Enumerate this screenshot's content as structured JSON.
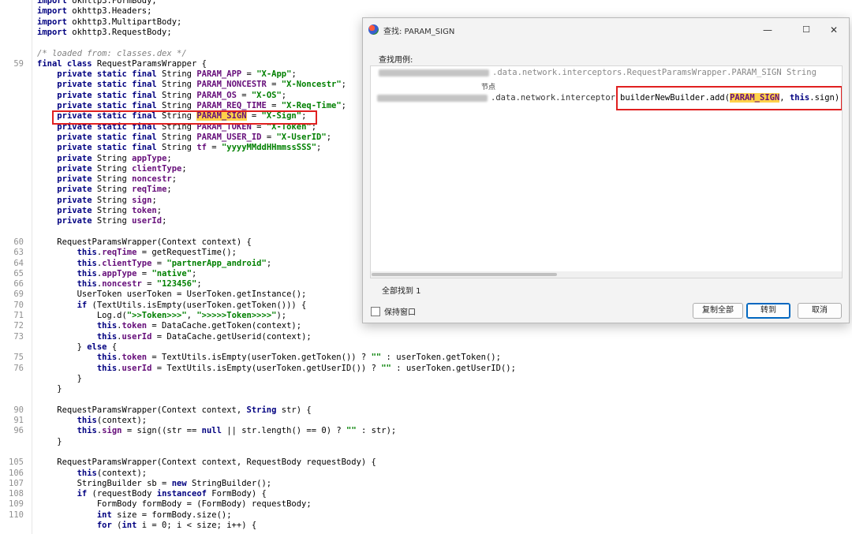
{
  "code_lines": [
    {
      "n": "",
      "html": "<span class=\"kw\">import</span> okhttp3.FormBody;"
    },
    {
      "n": "",
      "html": "<span class=\"kw\">import</span> okhttp3.Headers;"
    },
    {
      "n": "",
      "html": "<span class=\"kw\">import</span> okhttp3.MultipartBody;"
    },
    {
      "n": "",
      "html": "<span class=\"kw\">import</span> okhttp3.RequestBody;"
    },
    {
      "n": "",
      "html": ""
    },
    {
      "n": "",
      "html": "<span class=\"cm\">/* loaded from: classes.dex */</span>"
    },
    {
      "n": "59",
      "html": "<span class=\"kw\">final class</span> RequestParamsWrapper {"
    },
    {
      "n": "",
      "html": "    <span class=\"kw\">private static final</span> String <span class=\"fld\">PARAM_APP</span> = <span class=\"str\">\"X-App\"</span>;"
    },
    {
      "n": "",
      "html": "    <span class=\"kw\">private static final</span> String <span class=\"fld\">PARAM_NONCESTR</span> = <span class=\"str\">\"X-Noncestr\"</span>;"
    },
    {
      "n": "",
      "html": "    <span class=\"kw\">private static final</span> String <span class=\"fld\">PARAM_OS</span> = <span class=\"str\">\"X-OS\"</span>;"
    },
    {
      "n": "",
      "html": "    <span class=\"kw\">private static final</span> String <span class=\"fld\">PARAM_REQ_TIME</span> = <span class=\"str\">\"X-Req-Time\"</span>;"
    },
    {
      "n": "",
      "html": "    <span class=\"kw\">private static final</span> String <span class=\"fld hl\">PARAM_SIGN</span> = <span class=\"str\">\"X-Sign\"</span>;"
    },
    {
      "n": "",
      "html": "    <span class=\"kw\">private static final</span> String <span class=\"fld\">PARAM_TOKEN</span> = <span class=\"str\">\"X-Token\"</span>;"
    },
    {
      "n": "",
      "html": "    <span class=\"kw\">private static final</span> String <span class=\"fld\">PARAM_USER_ID</span> = <span class=\"str\">\"X-UserID\"</span>;"
    },
    {
      "n": "",
      "html": "    <span class=\"kw\">private static final</span> String <span class=\"fld\">tf</span> = <span class=\"str\">\"yyyyMMddHHmmssSSS\"</span>;"
    },
    {
      "n": "",
      "html": "    <span class=\"kw\">private</span> String <span class=\"fld\">appType</span>;"
    },
    {
      "n": "",
      "html": "    <span class=\"kw\">private</span> String <span class=\"fld\">clientType</span>;"
    },
    {
      "n": "",
      "html": "    <span class=\"kw\">private</span> String <span class=\"fld\">noncestr</span>;"
    },
    {
      "n": "",
      "html": "    <span class=\"kw\">private</span> String <span class=\"fld\">reqTime</span>;"
    },
    {
      "n": "",
      "html": "    <span class=\"kw\">private</span> String <span class=\"fld\">sign</span>;"
    },
    {
      "n": "",
      "html": "    <span class=\"kw\">private</span> String <span class=\"fld\">token</span>;"
    },
    {
      "n": "",
      "html": "    <span class=\"kw\">private</span> String <span class=\"fld\">userId</span>;"
    },
    {
      "n": "",
      "html": ""
    },
    {
      "n": "60",
      "html": "    RequestParamsWrapper(Context context) {"
    },
    {
      "n": "63",
      "html": "        <span class=\"kw\">this</span>.<span class=\"fld\">reqTime</span> = getRequestTime();"
    },
    {
      "n": "64",
      "html": "        <span class=\"kw\">this</span>.<span class=\"fld\">clientType</span> = <span class=\"str\">\"partnerApp_android\"</span>;"
    },
    {
      "n": "65",
      "html": "        <span class=\"kw\">this</span>.<span class=\"fld\">appType</span> = <span class=\"str\">\"native\"</span>;"
    },
    {
      "n": "66",
      "html": "        <span class=\"kw\">this</span>.<span class=\"fld\">noncestr</span> = <span class=\"str\">\"123456\"</span>;"
    },
    {
      "n": "69",
      "html": "        UserToken userToken = UserToken.getInstance();"
    },
    {
      "n": "70",
      "html": "        <span class=\"kw\">if</span> (TextUtils.isEmpty(userToken.getToken())) {"
    },
    {
      "n": "71",
      "html": "            Log.d(<span class=\"str\">\">>Token>>>\"</span>, <span class=\"str\">\">>>>>Token>>>>\"</span>);"
    },
    {
      "n": "72",
      "html": "            <span class=\"kw\">this</span>.<span class=\"fld\">token</span> = DataCache.getToken(context);"
    },
    {
      "n": "73",
      "html": "            <span class=\"kw\">this</span>.<span class=\"fld\">userId</span> = DataCache.getUserid(context);"
    },
    {
      "n": "",
      "html": "        } <span class=\"kw\">else</span> {"
    },
    {
      "n": "75",
      "html": "            <span class=\"kw\">this</span>.<span class=\"fld\">token</span> = TextUtils.isEmpty(userToken.getToken()) ? <span class=\"str\">\"\"</span> : userToken.getToken();"
    },
    {
      "n": "76",
      "html": "            <span class=\"kw\">this</span>.<span class=\"fld\">userId</span> = TextUtils.isEmpty(userToken.getUserID()) ? <span class=\"str\">\"\"</span> : userToken.getUserID();"
    },
    {
      "n": "",
      "html": "        }"
    },
    {
      "n": "",
      "html": "    }"
    },
    {
      "n": "",
      "html": ""
    },
    {
      "n": "90",
      "html": "    RequestParamsWrapper(Context context, <span class=\"kw\">String</span> str) {"
    },
    {
      "n": "91",
      "html": "        <span class=\"kw\">this</span>(context);"
    },
    {
      "n": "96",
      "html": "        <span class=\"kw\">this</span>.<span class=\"fld\">sign</span> = sign((str == <span class=\"kw\">null</span> || str.length() == 0) ? <span class=\"str\">\"\"</span> : str);"
    },
    {
      "n": "",
      "html": "    }"
    },
    {
      "n": "",
      "html": ""
    },
    {
      "n": "105",
      "html": "    RequestParamsWrapper(Context context, RequestBody requestBody) {"
    },
    {
      "n": "106",
      "html": "        <span class=\"kw\">this</span>(context);"
    },
    {
      "n": "107",
      "html": "        StringBuilder sb = <span class=\"kw\">new</span> StringBuilder();"
    },
    {
      "n": "108",
      "html": "        <span class=\"kw\">if</span> (requestBody <span class=\"kw\">instanceof</span> FormBody) {"
    },
    {
      "n": "109",
      "html": "            FormBody formBody = (FormBody) requestBody;"
    },
    {
      "n": "110",
      "html": "            <span class=\"kw\">int</span> size = formBody.size();"
    },
    {
      "n": "",
      "html": "            <span class=\"kw\">for</span> (<span class=\"kw\">int</span> i = 0; i &lt; size; i++) {"
    }
  ],
  "dialog": {
    "title": "查找: PARAM_SIGN",
    "caption": "查找用例:",
    "row0_tail": ".data.network.interceptors.RequestParamsWrapper.PARAM_SIGN String",
    "node_header": "节点",
    "row1_pkg": ".data.network.interceptor",
    "row1_code_pre": "builderNewBuilder.add(",
    "row1_code_hl": "PARAM_SIGN",
    "row1_code_mid": ", ",
    "row1_code_kw": "this",
    "row1_code_post": ".sign);",
    "count_label": "全部找到 1",
    "keep_window_label": "保持窗口",
    "copy_all_label": "复制全部",
    "goto_label": "转到",
    "cancel_label": "取消",
    "minimize_glyph": "—",
    "maximize_glyph": "☐",
    "close_glyph": "✕"
  }
}
